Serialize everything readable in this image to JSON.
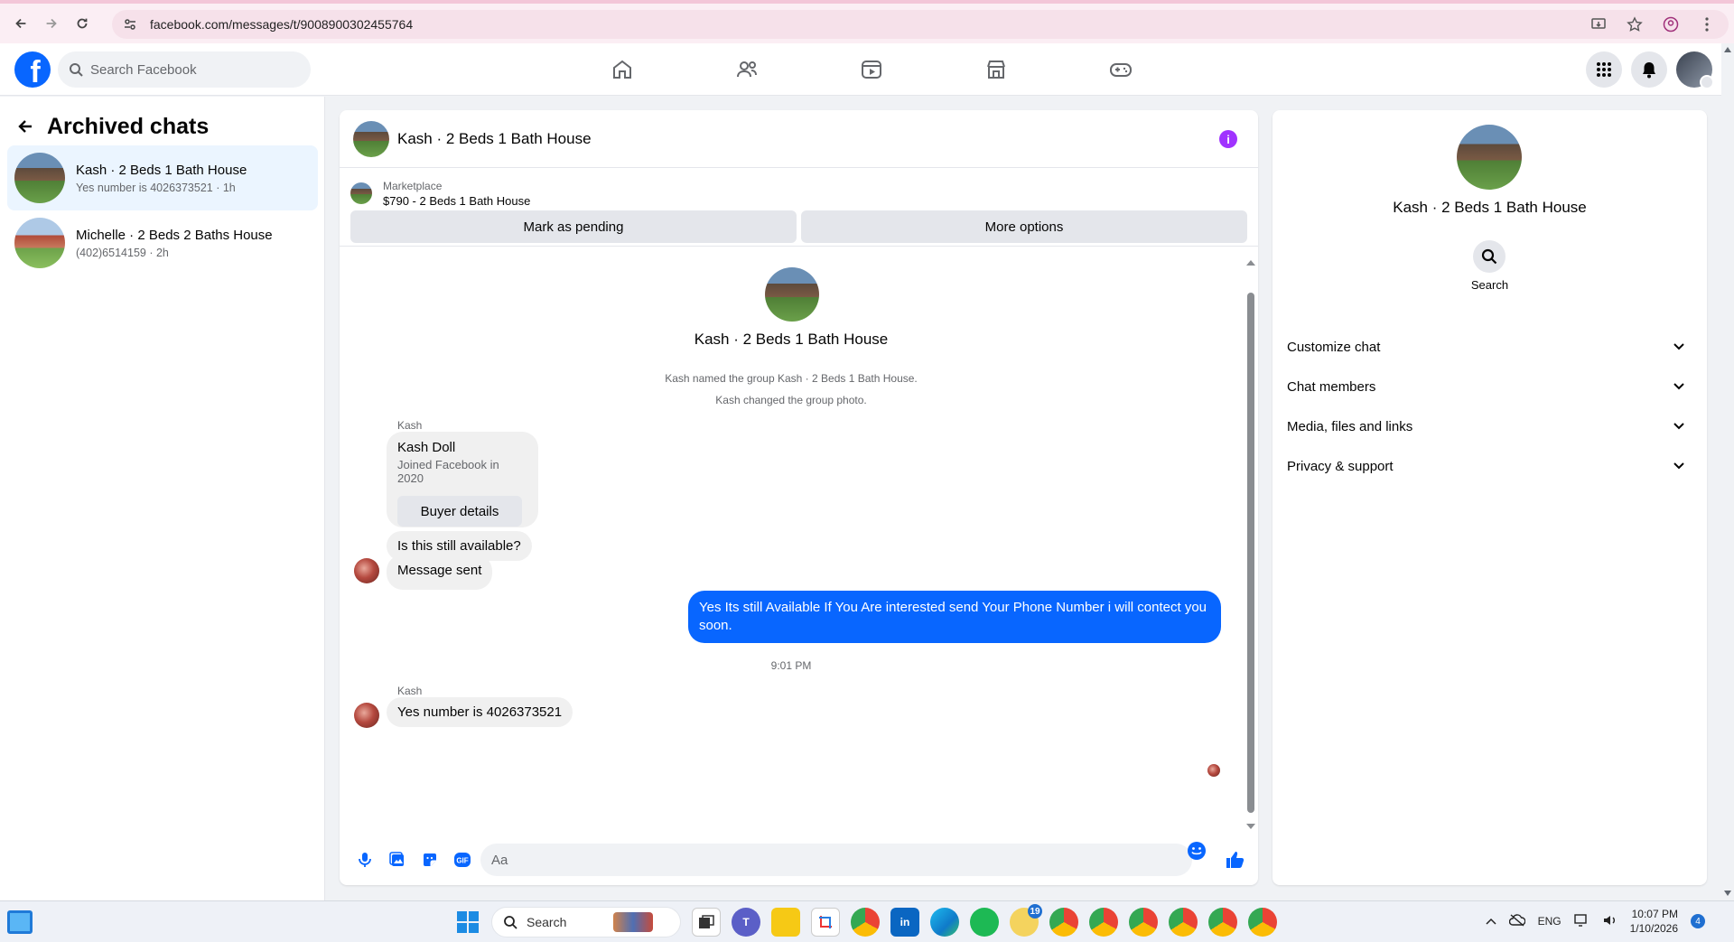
{
  "browser": {
    "url": "facebook.com/messages/t/9008900302455764"
  },
  "header": {
    "search_placeholder": "Search Facebook",
    "nav": [
      "home-icon",
      "friends-icon",
      "video-icon",
      "marketplace-icon",
      "gaming-icon"
    ]
  },
  "sidebar": {
    "title": "Archived chats",
    "chats": [
      {
        "name": "Kash · 2 Beds 1 Bath House",
        "preview": "Yes number is 4026373521 · 1h"
      },
      {
        "name": "Michelle · 2 Beds 2 Baths House",
        "preview": "(402)6514159 · 2h"
      }
    ]
  },
  "conversation": {
    "title": "Kash · 2 Beds 1 Bath House",
    "marketplace_label": "Marketplace",
    "listing": "$790 - 2 Beds 1 Bath House",
    "mark_pending_label": "Mark as pending",
    "more_options_label": "More options",
    "group_title": "Kash · 2 Beds 1 Bath House",
    "system_messages": [
      "Kash named the group Kash · 2 Beds 1 Bath House.",
      "Kash changed the group photo."
    ],
    "sender_label": "Kash",
    "buyer_card": {
      "name": "Kash Doll",
      "joined": "Joined Facebook in 2020",
      "button_label": "Buyer details"
    },
    "msg_available": "Is this still available?",
    "msg_sent": "Message sent",
    "msg_out": "Yes Its still Available If You Are interested send Your Phone Number i will contect you soon.",
    "timestamp": "9:01 PM",
    "sender_label_2": "Kash",
    "msg_number": "Yes number is 4026373521",
    "composer_placeholder": "Aa"
  },
  "right_panel": {
    "title": "Kash · 2 Beds 1 Bath House",
    "search_label": "Search",
    "sections": [
      "Customize chat",
      "Chat members",
      "Media, files and links",
      "Privacy & support"
    ]
  },
  "taskbar": {
    "search_label": "Search",
    "lang": "ENG",
    "time": "10:07 PM",
    "date": "1/10/2026",
    "notification_count": "4",
    "app_badge": "19"
  },
  "colors": {
    "brand_blue": "#0866ff",
    "info_purple": "#a033ff"
  }
}
